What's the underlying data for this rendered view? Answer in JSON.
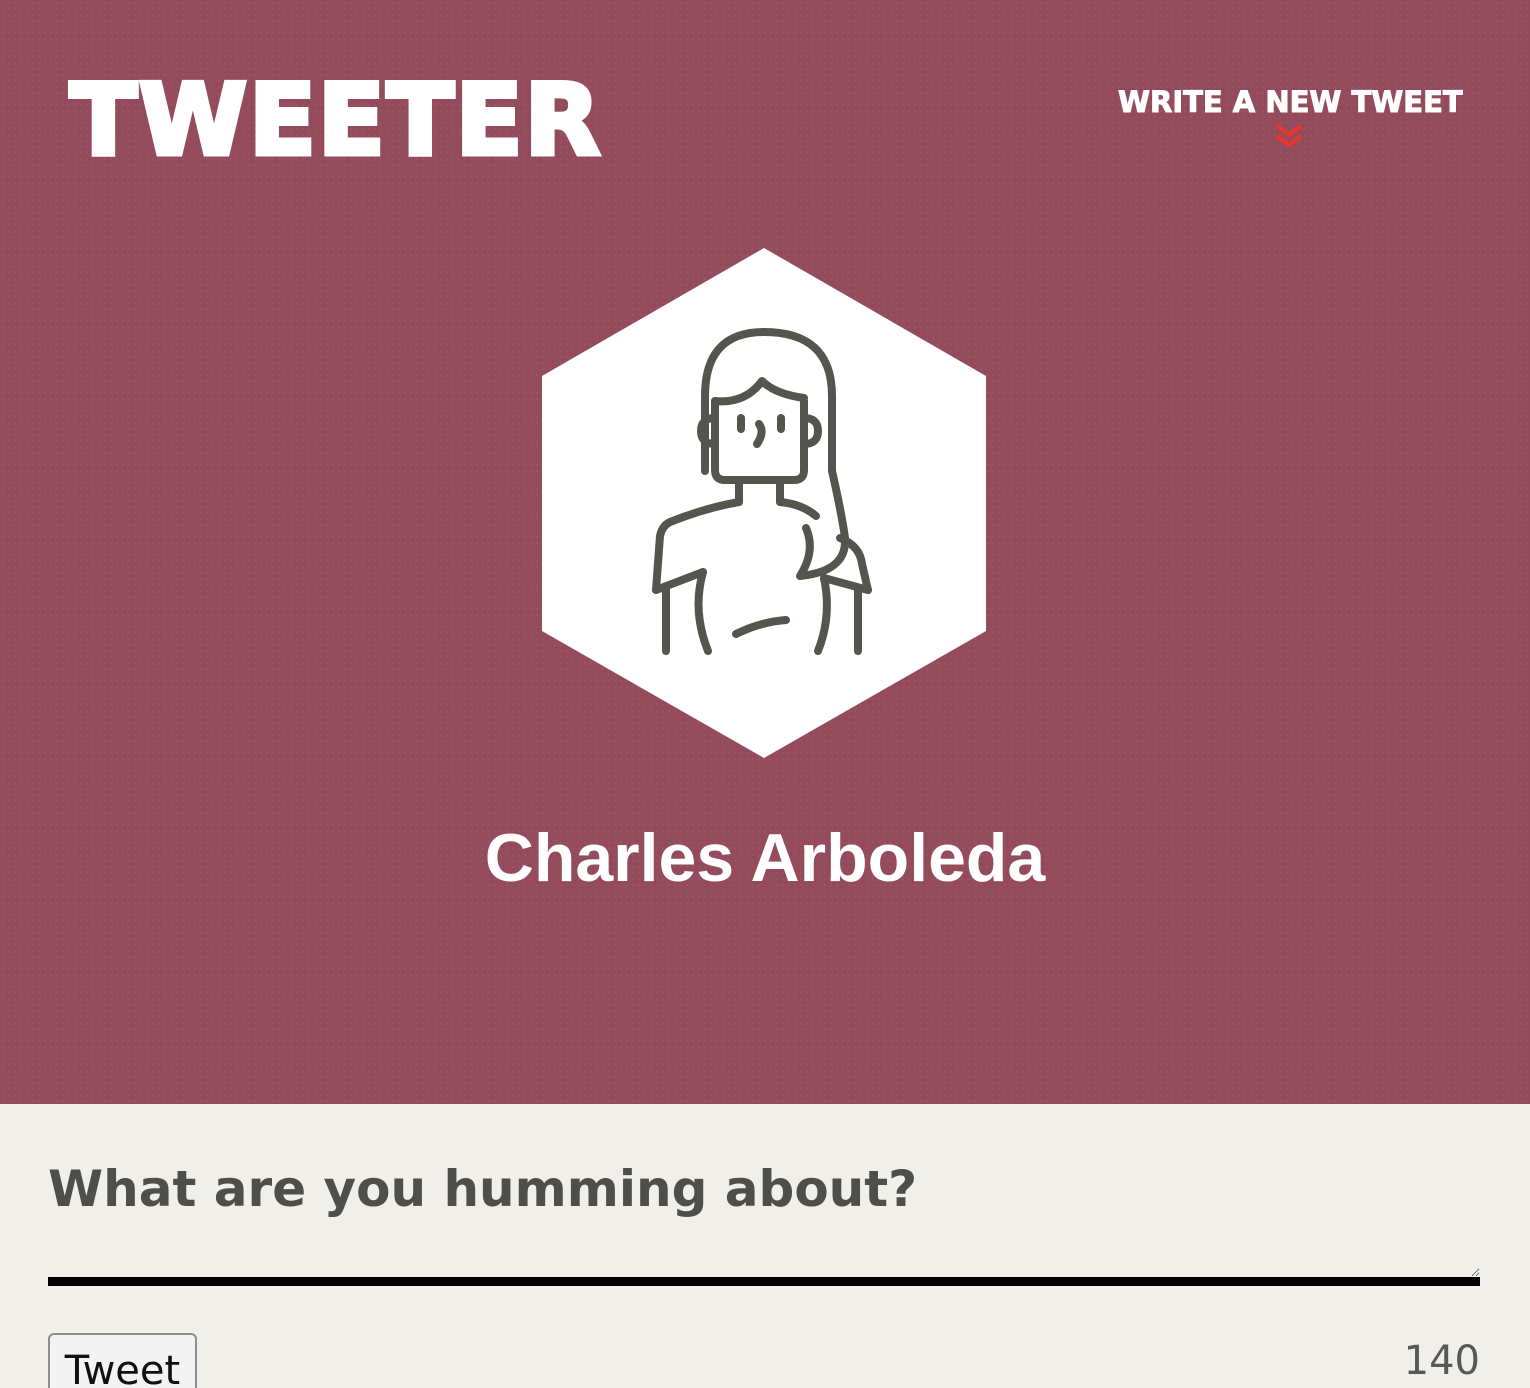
{
  "header": {
    "logo_text": "TWEETER",
    "nav": {
      "label": "WRITE A NEW TWEET",
      "icon": "double-chevron-down-icon"
    }
  },
  "profile": {
    "name": "Charles Arboleda",
    "avatar_icon": "woman-avatar-icon"
  },
  "composer": {
    "label": "What are you humming about?",
    "input_value": "",
    "submit_label": "Tweet",
    "char_count": "140"
  },
  "colors": {
    "hero_background": "#944c5c",
    "composer_background": "#f0efea",
    "accent_red": "#e8372a",
    "avatar_line": "#55554f",
    "label_text": "#4e4e4a"
  }
}
